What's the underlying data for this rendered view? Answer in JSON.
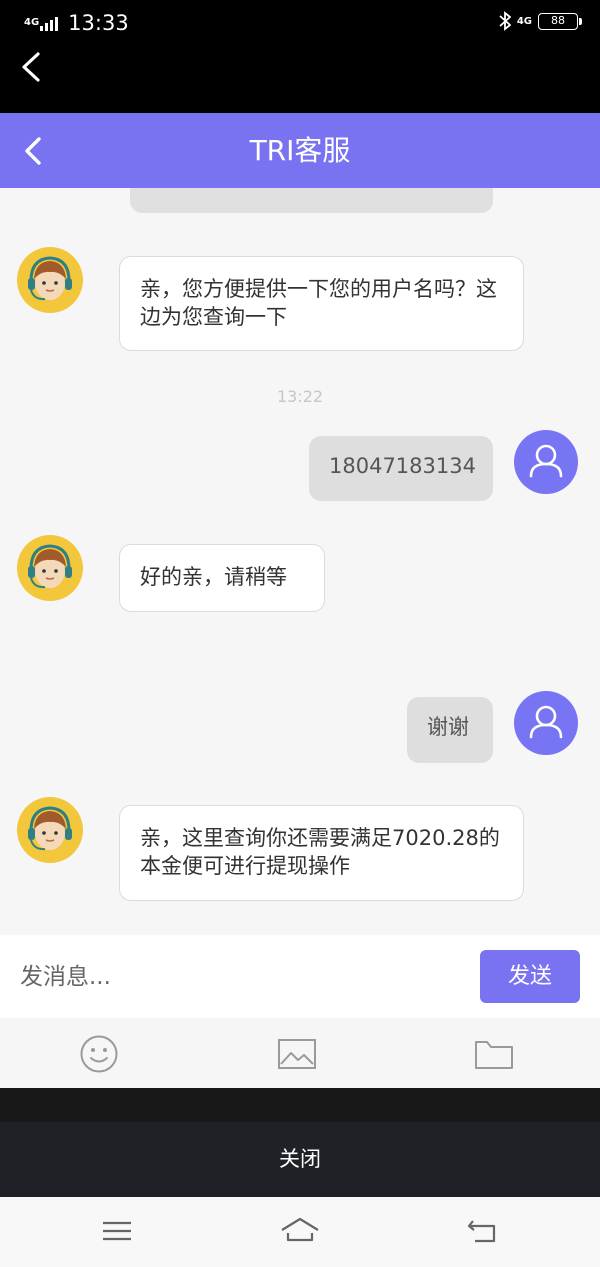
{
  "status_bar": {
    "network_left": "4G",
    "time": "13:33",
    "network_right": "4G",
    "battery": "88"
  },
  "header": {
    "title": "TRI客服"
  },
  "messages": [
    {
      "from": "agent",
      "text": "亲，您方便提供一下您的用户名吗？这边为您查询一下"
    },
    {
      "from": "timestamp",
      "text": "13:22"
    },
    {
      "from": "user",
      "text": "18047183134"
    },
    {
      "from": "agent",
      "text": "好的亲，请稍等"
    },
    {
      "from": "user",
      "text": "谢谢"
    },
    {
      "from": "agent",
      "text": "亲，这里查询你还需要满足7020.28的本金便可进行提现操作"
    }
  ],
  "composer": {
    "placeholder": "发消息...",
    "send_label": "发送"
  },
  "toolbar": {
    "icons": [
      "emoji-icon",
      "image-icon",
      "folder-icon"
    ]
  },
  "close_label": "关闭",
  "colors": {
    "accent": "#7972f1",
    "agent_avatar": "#f2c73c",
    "user_avatar": "#7875f4"
  }
}
